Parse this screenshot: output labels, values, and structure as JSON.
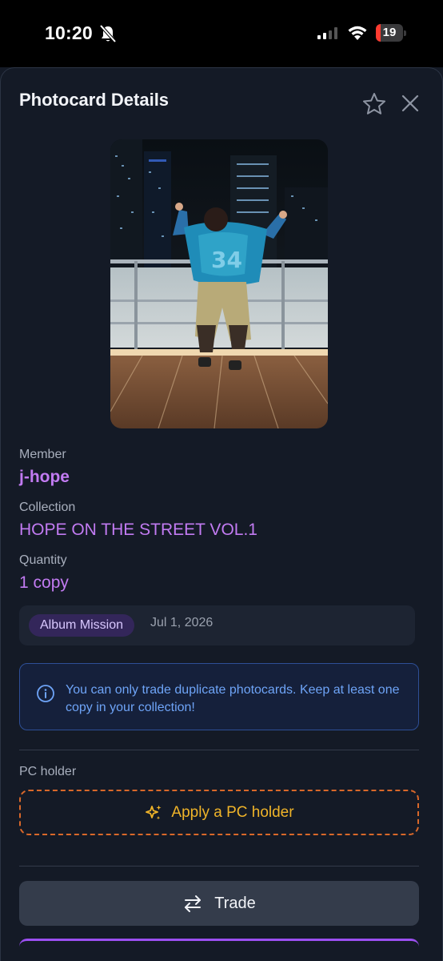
{
  "status_bar": {
    "time": "10:20",
    "battery_level": "19",
    "battery_fraction": 0.19,
    "signal_bars_active": 2,
    "signal_bars_total": 4,
    "icons": [
      "bell-slash-icon",
      "signal-icon",
      "wifi-icon",
      "battery-icon"
    ]
  },
  "header": {
    "title": "Photocard Details",
    "favorite_icon": "star-outline-icon",
    "close_icon": "close-icon"
  },
  "details": {
    "member_label": "Member",
    "member_value": "j-hope",
    "collection_label": "Collection",
    "collection_value": "HOPE ON THE STREET VOL.1",
    "quantity_label": "Quantity",
    "quantity_value": "1 copy"
  },
  "mission": {
    "badge": "Album Mission",
    "date": "Jul 1, 2026"
  },
  "info": {
    "icon": "info-circle-icon",
    "text": "You can only trade duplicate photocards. Keep at least one copy in your collection!"
  },
  "pc_holder": {
    "label": "PC holder",
    "button_label": "Apply a PC holder",
    "icon": "sparkles-icon"
  },
  "actions": {
    "trade_label": "Trade",
    "trade_icon": "swap-arrows-icon"
  },
  "colors": {
    "accent_purple": "#c27bf2",
    "info_blue": "#6ea4f7",
    "holder_orange": "#d9682a",
    "holder_text": "#f0b429",
    "battery_red": "#ff3b30"
  }
}
